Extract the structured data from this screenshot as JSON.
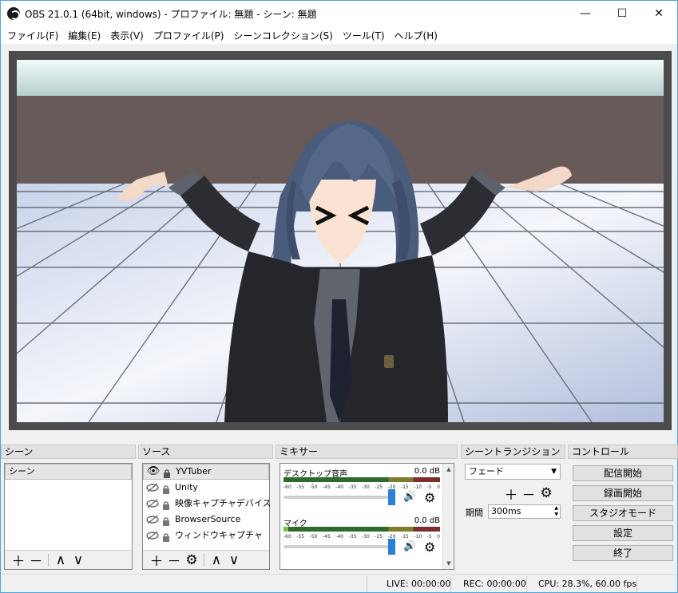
{
  "window": {
    "title": "OBS 21.0.1 (64bit, windows) - プロファイル: 無題 - シーン: 無題",
    "controls": {
      "minimize": "—",
      "maximize": "☐",
      "close": "✕"
    }
  },
  "menu": [
    "ファイル(F)",
    "編集(E)",
    "表示(V)",
    "プロファイル(P)",
    "シーンコレクション(S)",
    "ツール(T)",
    "ヘルプ(H)"
  ],
  "docks": {
    "scenes": {
      "title": "シーン",
      "items": [
        {
          "label": "シーン",
          "selected": true
        }
      ]
    },
    "sources": {
      "title": "ソース",
      "items": [
        {
          "label": "YVTuber",
          "visible": true,
          "selected": true
        },
        {
          "label": "Unity",
          "visible": false
        },
        {
          "label": "映像キャプチャデバイス",
          "visible": false
        },
        {
          "label": "BrowserSource",
          "visible": false
        },
        {
          "label": "ウィンドウキャプチャ",
          "visible": false
        }
      ]
    },
    "mixer": {
      "title": "ミキサー",
      "channels": [
        {
          "name": "デスクトップ音声",
          "db": "0.0 dB",
          "level": 0,
          "volume": 1.0
        },
        {
          "name": "マイク",
          "db": "0.0 dB",
          "level": 0.03,
          "volume": 1.0
        }
      ],
      "ticks": [
        "-60",
        "-55",
        "-50",
        "-45",
        "-40",
        "-35",
        "-30",
        "-25",
        "-20",
        "-15",
        "-10",
        "-5",
        "0"
      ]
    },
    "transitions": {
      "title": "シーントランジション",
      "selected": "フェード",
      "duration_label": "期間",
      "duration_value": "300ms"
    },
    "controls": {
      "title": "コントロール",
      "buttons": [
        "配信開始",
        "録画開始",
        "スタジオモード",
        "設定",
        "終了"
      ]
    }
  },
  "status": {
    "live": "LIVE: 00:00:00",
    "rec": "REC: 00:00:00",
    "cpu": "CPU: 28.3%, 60.00 fps"
  }
}
